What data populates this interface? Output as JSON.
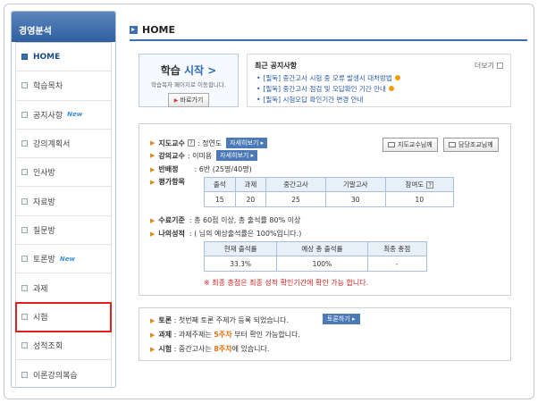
{
  "sidebar": {
    "title": "경영분석",
    "items": [
      {
        "label": "HOME",
        "new": ""
      },
      {
        "label": "학습목차",
        "new": ""
      },
      {
        "label": "공지사항",
        "new": "New"
      },
      {
        "label": "강의계획서",
        "new": ""
      },
      {
        "label": "인사방",
        "new": ""
      },
      {
        "label": "자료방",
        "new": ""
      },
      {
        "label": "질문방",
        "new": ""
      },
      {
        "label": "토론방",
        "new": "New"
      },
      {
        "label": "과제",
        "new": ""
      },
      {
        "label": "시험",
        "new": ""
      },
      {
        "label": "성적조회",
        "new": ""
      },
      {
        "label": "이론강의복습",
        "new": ""
      }
    ]
  },
  "main": {
    "title": "HOME"
  },
  "start": {
    "big_prefix": "학습",
    "big_blue": "시작 >",
    "sub": "학습목차 페이지로 이동합니다.",
    "button": "바로가기"
  },
  "notice": {
    "title": "최근 공지사항",
    "more": "더보기",
    "items": [
      "[필독] 중간고사 시험 중 오류 발생시 대처방법",
      "[필독] 중간고사 점검 및 오답확인 기간 안내",
      "[필독] 시험오답 확인기간 변경 안내"
    ]
  },
  "info": {
    "professor_label": "지도교수",
    "professor_name": ": 정연도",
    "tutor_label": "강의교수",
    "tutor_name": ": 이미용",
    "detail_tag": "자세히보기",
    "mail_professor": "지도교수님께",
    "mail_tutor": "담당조교님께",
    "class_label": "반배정",
    "class_value": ": 6반 (25명/40명)",
    "eval_label": "평가항목",
    "eval_headers": [
      "출석",
      "과제",
      "중간고사",
      "기말고사",
      "참여도"
    ],
    "eval_values": [
      "15",
      "20",
      "25",
      "30",
      "10"
    ],
    "criteria_label": "수료기준",
    "criteria_value": ": 총 60점 이상, 총 출석률 80% 이상",
    "mygrade_label": "나의성적",
    "mygrade_value": ": (     님의 예상출석률은 100%입니다.)",
    "grade_headers": [
      "현재 출석률",
      "예상 총 출석률",
      "최종 총점"
    ],
    "grade_values": [
      "33.3%",
      "100%",
      "-"
    ],
    "warning": "※ 최종 총점은 최종 성적 확인기간에 확인 가능 합니다."
  },
  "bottom": {
    "toron_label": "토론",
    "toron_text": ": 첫번째 토론 주제가 등록 되었습니다.",
    "toron_button": "토론하기",
    "task_label": "과제",
    "task_text_a": ": 과제주제는",
    "task_week": "5주차",
    "task_text_b": "부터 확인 가능합니다.",
    "exam_label": "시험",
    "exam_text_a": ": 중간고사는",
    "exam_week": "8주차",
    "exam_text_b": "에 있습니다."
  }
}
